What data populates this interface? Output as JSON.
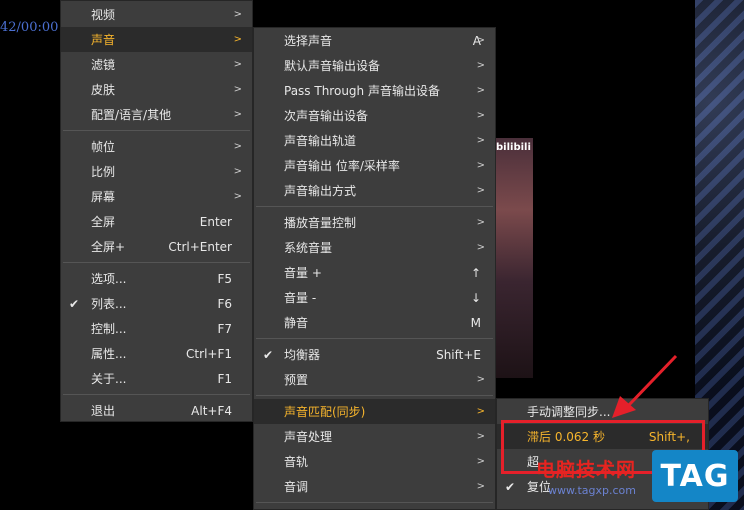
{
  "background": {
    "time_text": "42/00:00"
  },
  "thumbnail": {
    "label": "bilibili"
  },
  "main_menu": [
    {
      "label": "视频",
      "arrow": ">"
    },
    {
      "label": "声音",
      "arrow": ">",
      "active": true
    },
    {
      "label": "滤镜",
      "arrow": ">"
    },
    {
      "label": "皮肤",
      "arrow": ">"
    },
    {
      "label": "配置/语言/其他",
      "arrow": ">"
    },
    {
      "label": "帧位",
      "arrow": ">"
    },
    {
      "label": "比例",
      "arrow": ">"
    },
    {
      "label": "屏幕",
      "arrow": ">"
    },
    {
      "label": "全屏",
      "shortcut": "Enter"
    },
    {
      "label": "全屏+",
      "shortcut": "Ctrl+Enter"
    },
    {
      "label": "选项...",
      "shortcut": "F5"
    },
    {
      "label": "列表...",
      "shortcut": "F6",
      "checked": true
    },
    {
      "label": "控制...",
      "shortcut": "F7"
    },
    {
      "label": "属性...",
      "shortcut": "Ctrl+F1"
    },
    {
      "label": "关于...",
      "shortcut": "F1"
    },
    {
      "label": "退出",
      "shortcut": "Alt+F4"
    }
  ],
  "audio_menu": [
    {
      "label": "选择声音",
      "shortcut": "A",
      "arrow": ">"
    },
    {
      "label": "默认声音输出设备",
      "arrow": ">"
    },
    {
      "label": "Pass Through 声音输出设备",
      "arrow": ">"
    },
    {
      "label": "次声音输出设备",
      "arrow": ">"
    },
    {
      "label": "声音输出轨道",
      "arrow": ">"
    },
    {
      "label": "声音输出 位率/采样率",
      "arrow": ">"
    },
    {
      "label": "声音输出方式",
      "arrow": ">"
    },
    {
      "label": "播放音量控制",
      "arrow": ">"
    },
    {
      "label": "系统音量",
      "arrow": ">"
    },
    {
      "label": "音量 +",
      "shortcut": "↑"
    },
    {
      "label": "音量 -",
      "shortcut": "↓"
    },
    {
      "label": "静音",
      "shortcut": "M"
    },
    {
      "label": "均衡器",
      "shortcut": "Shift+E",
      "checked": true
    },
    {
      "label": "预置",
      "arrow": ">"
    },
    {
      "label": "声音匹配(同步)",
      "arrow": ">",
      "active": true
    },
    {
      "label": "声音处理",
      "arrow": ">"
    },
    {
      "label": "音轨",
      "arrow": ">"
    },
    {
      "label": "音调",
      "arrow": ">"
    }
  ],
  "sync_menu": [
    {
      "label": "手动调整同步..."
    },
    {
      "label": "滞后 0.062 秒",
      "shortcut": "Shift+,",
      "highlight": true
    },
    {
      "label": "超"
    },
    {
      "label": "复位",
      "checked": true
    }
  ],
  "watermark": {
    "site_name": "电脑技术网",
    "url": "www.tagxp.com",
    "tag": "TAG"
  },
  "colors": {
    "accent": "#f7b52c",
    "annotation": "#e5202a",
    "menu_bg": "#3d3d3d"
  }
}
